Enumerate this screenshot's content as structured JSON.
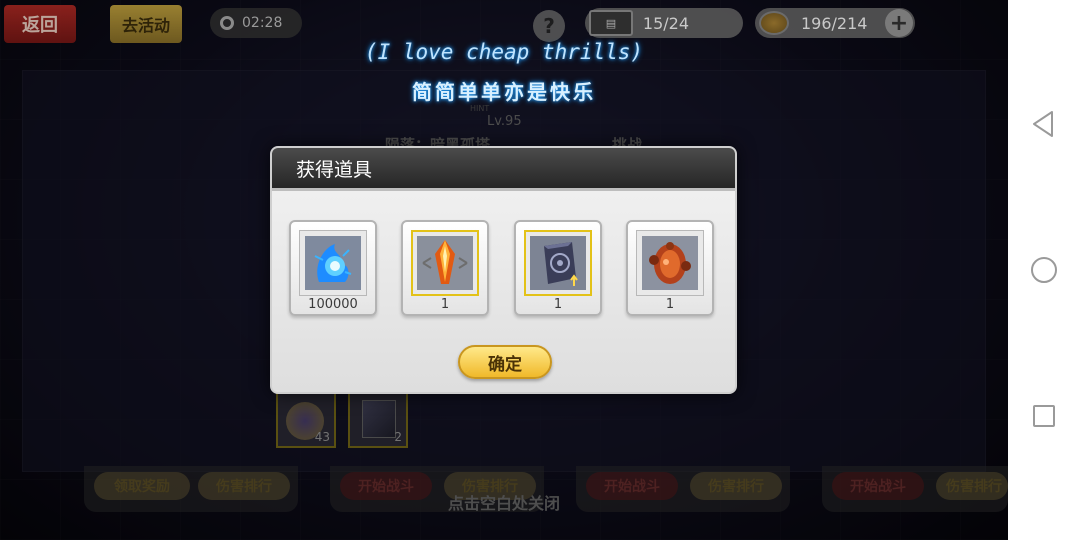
{
  "top_bar": {
    "back_label": "返回",
    "goto_event_label": "去活动",
    "timer": "02:28",
    "help_label": "?",
    "stamina": "15/24",
    "currency": "196/214",
    "plus_label": "+"
  },
  "subtitles": {
    "english": "(I love cheap thrills)",
    "chinese": "简简单单亦是快乐"
  },
  "background": {
    "boss_hint": "HINT",
    "boss_level": "Lv.95",
    "boss_name_left": "陨落：暗黑孤塔",
    "boss_name_right": "挑战",
    "rewards": [
      {
        "count": "43"
      },
      {
        "count": "2"
      }
    ],
    "panel_buttons": [
      {
        "label": "领取奖励"
      },
      {
        "label": "伤害排行"
      },
      {
        "label": "开始战斗"
      },
      {
        "label": "伤害排行"
      },
      {
        "label": "开始战斗"
      },
      {
        "label": "伤害排行"
      },
      {
        "label": "开始战斗"
      },
      {
        "label": "伤害排行"
      }
    ],
    "close_hint": "点击空白处关闭"
  },
  "dialog": {
    "title": "获得道具",
    "items": [
      {
        "icon": "blue-energy-icon",
        "count": "100000",
        "frame": "silver"
      },
      {
        "icon": "orange-crystal-icon",
        "count": "1",
        "frame": "gold"
      },
      {
        "icon": "dark-cube-icon",
        "count": "1",
        "frame": "gold"
      },
      {
        "icon": "rust-core-icon",
        "count": "1",
        "frame": "silver"
      }
    ],
    "confirm_label": "确定"
  },
  "colors": {
    "dialog_header": "#262626",
    "confirm_button": "#f0b92a",
    "gold_frame": "#e3c218",
    "subtitle_glow": "#1d8fe6"
  }
}
